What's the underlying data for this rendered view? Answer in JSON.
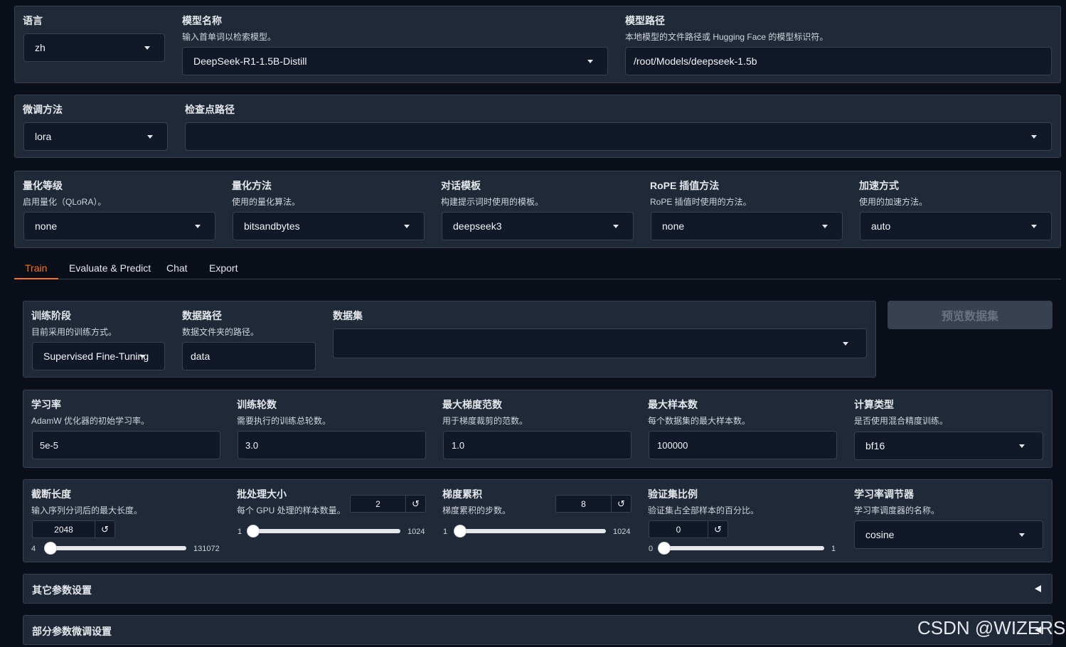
{
  "top": {
    "language": {
      "label": "语言",
      "value": "zh"
    },
    "model_name": {
      "label": "模型名称",
      "info": "输入首单词以检索模型。",
      "value": "DeepSeek-R1-1.5B-Distill"
    },
    "model_path": {
      "label": "模型路径",
      "info": "本地模型的文件路径或 Hugging Face 的模型标识符。",
      "value": "/root/Models/deepseek-1.5b"
    }
  },
  "finetune": {
    "method": {
      "label": "微调方法",
      "value": "lora"
    },
    "checkpoint": {
      "label": "检查点路径",
      "value": ""
    }
  },
  "advanced": {
    "quant_bit": {
      "label": "量化等级",
      "info": "启用量化（QLoRA）。",
      "value": "none"
    },
    "quant_method": {
      "label": "量化方法",
      "info": "使用的量化算法。",
      "value": "bitsandbytes"
    },
    "template": {
      "label": "对话模板",
      "info": "构建提示词时使用的模板。",
      "value": "deepseek3"
    },
    "rope": {
      "label": "RoPE 插值方法",
      "info": "RoPE 插值时使用的方法。",
      "value": "none"
    },
    "booster": {
      "label": "加速方式",
      "info": "使用的加速方法。",
      "value": "auto"
    }
  },
  "tabs": [
    "Train",
    "Evaluate & Predict",
    "Chat",
    "Export"
  ],
  "train": {
    "stage": {
      "label": "训练阶段",
      "info": "目前采用的训练方式。",
      "value": "Supervised Fine-Tuning"
    },
    "dataset_dir": {
      "label": "数据路径",
      "info": "数据文件夹的路径。",
      "value": "data"
    },
    "dataset": {
      "label": "数据集",
      "value": ""
    },
    "preview_label": "预览数据集",
    "learning_rate": {
      "label": "学习率",
      "info": "AdamW 优化器的初始学习率。",
      "value": "5e-5"
    },
    "epochs": {
      "label": "训练轮数",
      "info": "需要执行的训练总轮数。",
      "value": "3.0"
    },
    "max_grad_norm": {
      "label": "最大梯度范数",
      "info": "用于梯度裁剪的范数。",
      "value": "1.0"
    },
    "max_samples": {
      "label": "最大样本数",
      "info": "每个数据集的最大样本数。",
      "value": "100000"
    },
    "compute_type": {
      "label": "计算类型",
      "info": "是否使用混合精度训练。",
      "value": "bf16"
    },
    "cutoff_len": {
      "label": "截断长度",
      "info": "输入序列分词后的最大长度。",
      "value": "2048",
      "min": "4",
      "max": "131072",
      "fraction": 0.015
    },
    "batch_size": {
      "label": "批处理大小",
      "info": "每个 GPU 处理的样本数量。",
      "value": "2",
      "min": "1",
      "max": "1024",
      "fraction": 0.001
    },
    "grad_accum": {
      "label": "梯度累积",
      "info": "梯度累积的步数。",
      "value": "8",
      "min": "1",
      "max": "1024",
      "fraction": 0.007
    },
    "val_size": {
      "label": "验证集比例",
      "info": "验证集占全部样本的百分比。",
      "value": "0",
      "min": "0",
      "max": "1",
      "fraction": 0
    },
    "scheduler": {
      "label": "学习率调节器",
      "info": "学习率调度器的名称。",
      "value": "cosine"
    },
    "reset_glyph": "↺",
    "extra_args": "其它参数设置",
    "freeze_args": "部分参数微调设置"
  },
  "watermark": "CSDN @WIZERS"
}
